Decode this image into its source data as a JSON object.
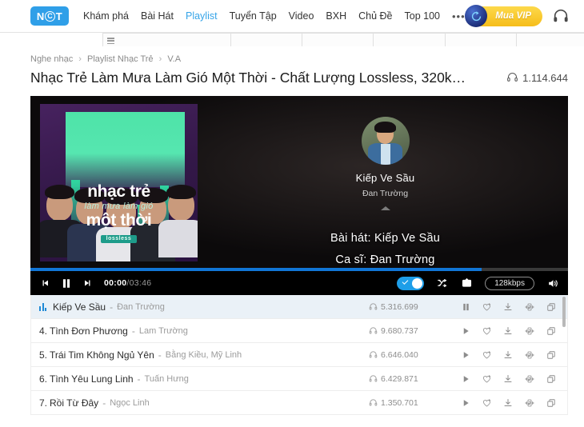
{
  "nav": {
    "logo": {
      "pre": "N",
      "ring": "C",
      "post": "T"
    },
    "links": [
      {
        "label": "Khám phá",
        "active": false
      },
      {
        "label": "Bài Hát",
        "active": false
      },
      {
        "label": "Playlist",
        "active": true
      },
      {
        "label": "Tuyển Tập",
        "active": false
      },
      {
        "label": "Video",
        "active": false
      },
      {
        "label": "BXH",
        "active": false
      },
      {
        "label": "Chủ Đề",
        "active": false
      },
      {
        "label": "Top 100",
        "active": false
      }
    ],
    "more": "•••",
    "vip_label": "Mua VIP",
    "vip_icon": "vip-orb-icon",
    "headphone_icon": "headphone-icon"
  },
  "breadcrumb": {
    "items": [
      "Nghe nhạc",
      "Playlist Nhạc Trẻ",
      "V.A"
    ],
    "separator": "›"
  },
  "header": {
    "title": "Nhạc Trẻ Làm Mưa Làm Gió Một Thời - Chất Lượng Lossless, 320k…",
    "listen_count": "1.114.644",
    "listen_icon": "headphone-icon"
  },
  "cover": {
    "line1": "nhạc trẻ",
    "line2": "làm mưa làm gió",
    "line3": "một thời",
    "badge": "lossless"
  },
  "now_playing": {
    "title": "Kiếp Ve Sầu",
    "artist": "Đan Trường",
    "karaoke_song": "Bài hát: Kiếp Ve Sầu",
    "karaoke_artist": "Ca sĩ: Đan Trường"
  },
  "controls": {
    "prev_icon": "previous-icon",
    "play_icon": "pause-icon",
    "next_icon": "next-icon",
    "current_time": "00:00",
    "separator": "/",
    "duration": "03:46",
    "progress_percent": 84,
    "toggle_on": true,
    "shuffle_icon": "shuffle-icon",
    "repeat_icon": "repeat-icon",
    "quality_label": "128kbps",
    "volume_icon": "volume-icon"
  },
  "playlist": {
    "rows": [
      {
        "number": "",
        "title": "Kiếp Ve Sầu",
        "artist": "Đan Trường",
        "plays": "5.316.699",
        "playing": true,
        "action_icon": "pause-icon"
      },
      {
        "number": "4.",
        "title": "Tình Đơn Phương",
        "artist": "Lam Trường",
        "plays": "9.680.737",
        "playing": false,
        "action_icon": "play-icon"
      },
      {
        "number": "5.",
        "title": "Trái Tim Không Ngủ Yên",
        "artist": "Bằng Kiều, Mỹ Linh",
        "plays": "6.646.040",
        "playing": false,
        "action_icon": "play-icon"
      },
      {
        "number": "6.",
        "title": "Tình Yêu Lung Linh",
        "artist": "Tuấn Hưng",
        "plays": "6.429.871",
        "playing": false,
        "action_icon": "play-icon"
      },
      {
        "number": "7.",
        "title": "Rồi Từ Đây",
        "artist": "Ngọc Linh",
        "plays": "1.350.701",
        "playing": false,
        "action_icon": "play-icon"
      }
    ],
    "row_action_icons": [
      "favorite-icon",
      "download-icon",
      "ringtone-icon",
      "copy-icon"
    ]
  },
  "colors": {
    "accent_blue": "#36a4e8",
    "progress_blue": "#1176d6",
    "vip_yellow": "#f6bd1a",
    "row_highlight": "#eaf1f7"
  }
}
